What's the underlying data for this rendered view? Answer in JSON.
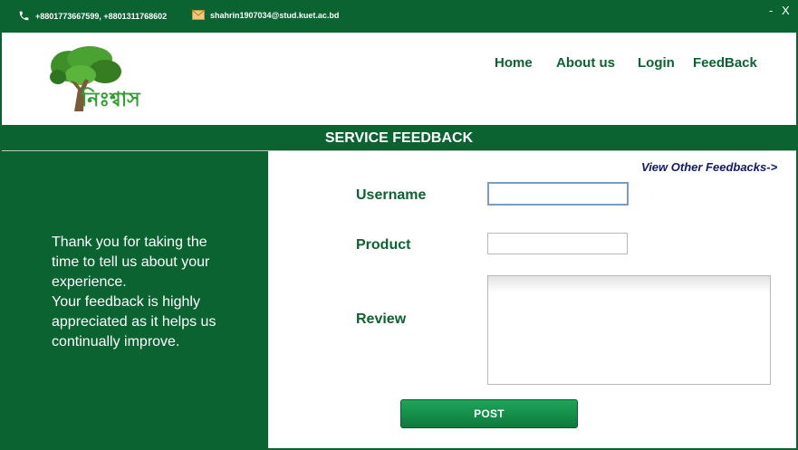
{
  "topbar": {
    "phone_icon": "phone-icon",
    "phone_text": "+8801773667599, +8801311768602",
    "email_icon": "mail-icon",
    "email_text": "shahrin1907034@stud.kuet.ac.bd",
    "minimize_label": "-",
    "close_label": "X"
  },
  "header": {
    "logo_text": "নিঃশ্বাস",
    "nav": [
      {
        "label": "Home"
      },
      {
        "label": "About us"
      },
      {
        "label": "Login"
      },
      {
        "label": "FeedBack"
      }
    ]
  },
  "title": "SERVICE FEEDBACK",
  "left_panel": {
    "lines": [
      "Thank you for taking the time to tell us about your experience.",
      "Your feedback is highly appreciated as it helps us continually improve."
    ]
  },
  "form": {
    "view_link": "View Other Feedbacks->",
    "username_label": "Username",
    "username_value": "",
    "product_label": "Product",
    "product_value": "",
    "review_label": "Review",
    "review_value": "",
    "post_label": "POST"
  },
  "colors": {
    "brand_green": "#0b6332",
    "link_navy": "#0d1a6e",
    "button_green": "#1ea55a"
  }
}
